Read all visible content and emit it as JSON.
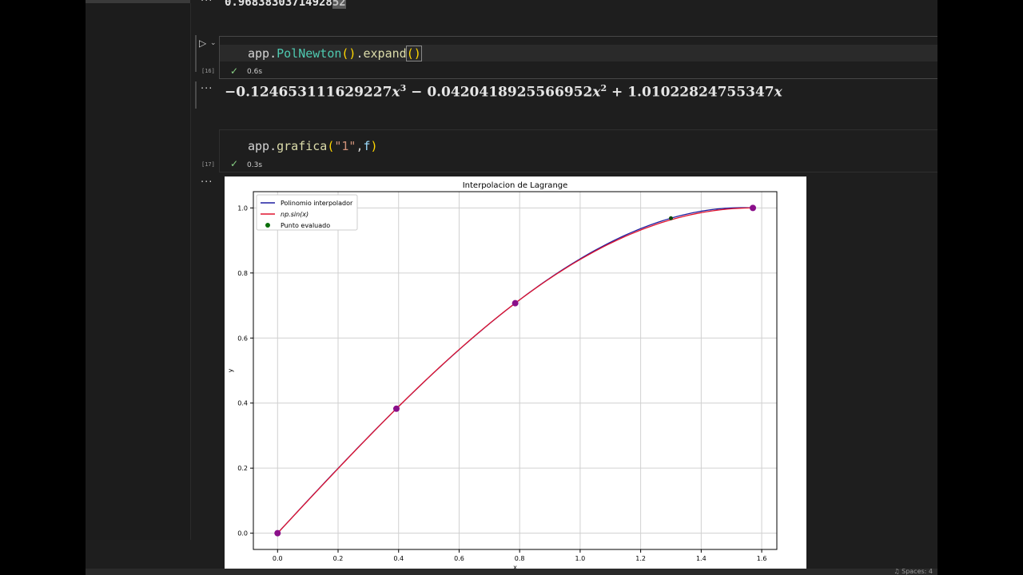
{
  "output_top": {
    "value": "0.96838303714928",
    "value_highlight": "52"
  },
  "cells": [
    {
      "exec_count": "[16]",
      "time": "0.6s"
    },
    {
      "exec_count": "[17]",
      "time": "0.3s"
    }
  ],
  "output_math": {
    "t1_coef": "−0.124653111629227",
    "t1_exp": "3",
    "op1": " − ",
    "t2_coef": "0.0420418925566952",
    "t2_exp": "2",
    "op2": " + ",
    "t3_coef": "1.01022824755347",
    "var": "x"
  },
  "status_bar": {
    "text": "♫ Spaces: 4"
  },
  "chart_data": {
    "type": "line",
    "title": "Interpolacion de Lagrange",
    "xlabel": "x",
    "ylabel": "y",
    "xlim": [
      -0.08,
      1.65
    ],
    "ylim": [
      -0.05,
      1.05
    ],
    "xticks": [
      "0.0",
      "0.2",
      "0.4",
      "0.6",
      "0.8",
      "1.0",
      "1.2",
      "1.4",
      "1.6"
    ],
    "yticks": [
      "0.0",
      "0.2",
      "0.4",
      "0.6",
      "0.8",
      "1.0"
    ],
    "grid": true,
    "legend_position": "top-left",
    "legend": [
      {
        "label": "Polinomio interpolador",
        "color": "#1f1fa0",
        "kind": "line"
      },
      {
        "label": "np.sin(x)",
        "color": "#e0142e",
        "kind": "line"
      },
      {
        "label": "Punto evaluado",
        "color": "#0a6e0a",
        "kind": "dot"
      }
    ],
    "series": [
      {
        "name": "Polinomio interpolador",
        "color": "#1f1fa0",
        "coefficients": [
          0,
          1.01022824755347,
          -0.0420418925566952,
          -0.124653111629227
        ]
      },
      {
        "name": "np.sin(x)",
        "color": "#e0142e",
        "function": "sin"
      }
    ],
    "nodes": {
      "color": "#8a0f8a",
      "x": [
        0,
        0.3927,
        0.7854,
        1.5708
      ],
      "y": [
        0,
        0.3827,
        0.7071,
        1.0
      ]
    },
    "evaluated_point": {
      "color": "#0a4a0a",
      "x": 1.3,
      "y": 0.9684
    },
    "x_range": [
      0,
      1.5708
    ]
  }
}
